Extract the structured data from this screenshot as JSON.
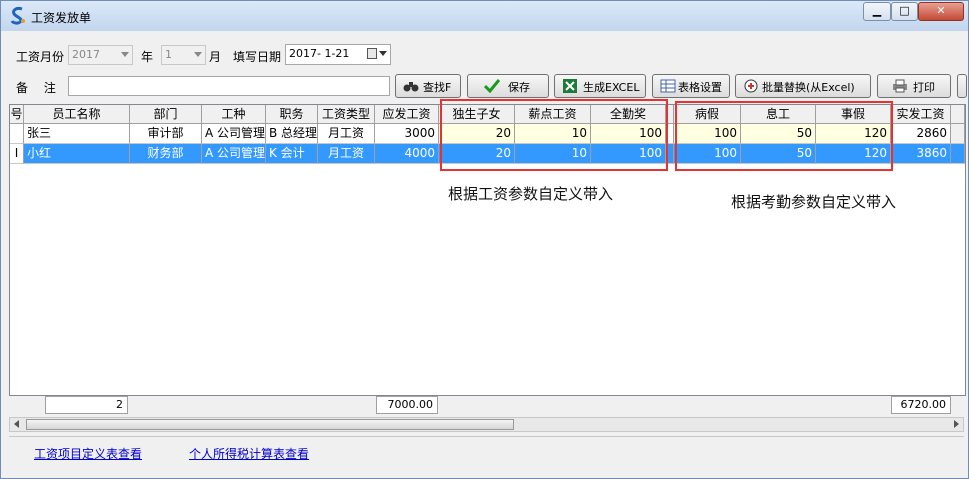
{
  "window": {
    "title": "工资发放单",
    "minimize_icon": "minimize-icon",
    "maximize_icon": "maximize-icon",
    "close_icon": "close-icon"
  },
  "filters": {
    "month_label": "工资月份",
    "year_value": "2017",
    "year_label": "年",
    "month_value": "1",
    "month_unit": "月",
    "fill_date_label": "填写日期",
    "fill_date_value": "2017- 1-21",
    "remark_label": "备　 注",
    "remark_value": ""
  },
  "toolbar": {
    "find": "查找F",
    "save": "保存",
    "excel": "生成EXCEL",
    "table_settings": "表格设置",
    "batch_replace": "批量替换(从Excel)",
    "print": "打印"
  },
  "table": {
    "headers": [
      "号",
      "员工名称",
      "部门",
      "工种",
      "职务",
      "工资类型",
      "应发工资",
      "独生子女",
      "薪点工资",
      "全勤奖",
      "",
      "病假",
      "息工",
      "事假",
      "实发工资"
    ],
    "rows": [
      {
        "no": "",
        "name": "张三",
        "dept": "审计部",
        "job": "A 公司管理",
        "post": "B 总经理",
        "type": "月工资",
        "due": "3000",
        "only_child": "20",
        "points": "10",
        "full_att": "100",
        "sick": "100",
        "rest": "50",
        "personal": "120",
        "actual": "2860"
      },
      {
        "no": "I",
        "name": "小红",
        "dept": "财务部",
        "job": "A 公司管理",
        "post": "K 会计",
        "type": "月工资",
        "due": "4000",
        "only_child": "20",
        "points": "10",
        "full_att": "100",
        "sick": "100",
        "rest": "50",
        "personal": "120",
        "actual": "3860"
      }
    ],
    "summary": {
      "count": "2",
      "due_total": "7000.00",
      "actual_total": "6720.00"
    }
  },
  "annotations": {
    "salary_params": "根据工资参数自定义带入",
    "attendance_params": "根据考勤参数自定义带入"
  },
  "links": {
    "salary_items": "工资项目定义表查看",
    "tax_calc": "个人所得税计算表查看"
  },
  "colors": {
    "selected_row": "#3399ff",
    "highlight_cell": "#ffffe1",
    "annotation_border": "#e53333",
    "link": "#0000cc"
  }
}
